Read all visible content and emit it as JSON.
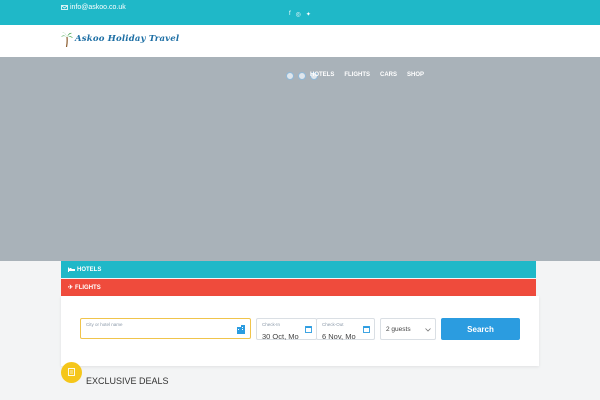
{
  "topbar": {
    "email": "info@askoo.co.uk",
    "socials": [
      "facebook-icon",
      "instagram-icon",
      "twitter-icon"
    ]
  },
  "brand": {
    "name": "Askoo Holiday Travel"
  },
  "nav": {
    "items": [
      "HOTELS",
      "FLIGHTS",
      "CARS",
      "SHOP"
    ]
  },
  "tabs": {
    "hotels": "HOTELS",
    "flights": "FLIGHTS"
  },
  "search": {
    "city_label": "City or hotel name",
    "city_value": "",
    "checkin_label": "Check-In",
    "checkin_value": "30 Oct, Mo",
    "checkout_label": "Check-Out",
    "checkout_value": "6 Nov, Mo",
    "guests_value": "2 guests",
    "button": "Search"
  },
  "section": {
    "title": "EXCLUSIVE DEALS"
  },
  "colors": {
    "teal": "#1fb8c8",
    "red": "#ef4b3c",
    "blue": "#2b9ce0",
    "yellow": "#f5c61a"
  }
}
